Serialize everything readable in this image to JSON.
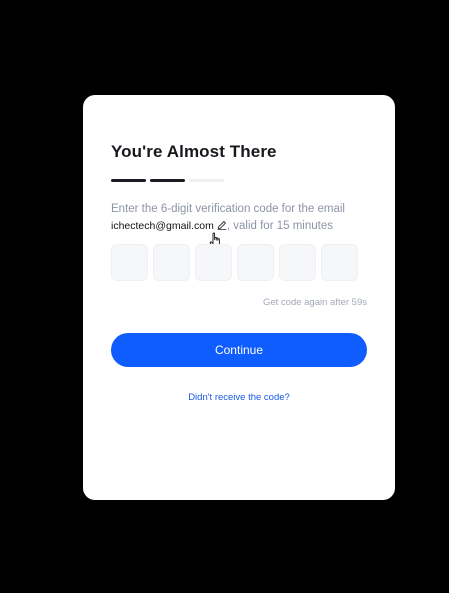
{
  "verification": {
    "title": "You're Almost There",
    "progress": {
      "total_steps": 3,
      "completed_steps": 2
    },
    "description_line1": "Enter the 6-digit verification code for the email",
    "email": "ichectech@gmail.com",
    "edit_icon": "pencil-icon",
    "description_suffix": ", valid for 15 minutes",
    "code_length": 6,
    "code_values": [
      "",
      "",
      "",
      "",
      "",
      ""
    ],
    "resend_timer": "Get code again after 59s",
    "continue_label": "Continue",
    "help_link": "Didn't receive the code?"
  },
  "colors": {
    "background": "#000000",
    "card": "#ffffff",
    "accent": "#0f5cff",
    "link": "#1658e8",
    "muted_text": "#8c94a3"
  }
}
